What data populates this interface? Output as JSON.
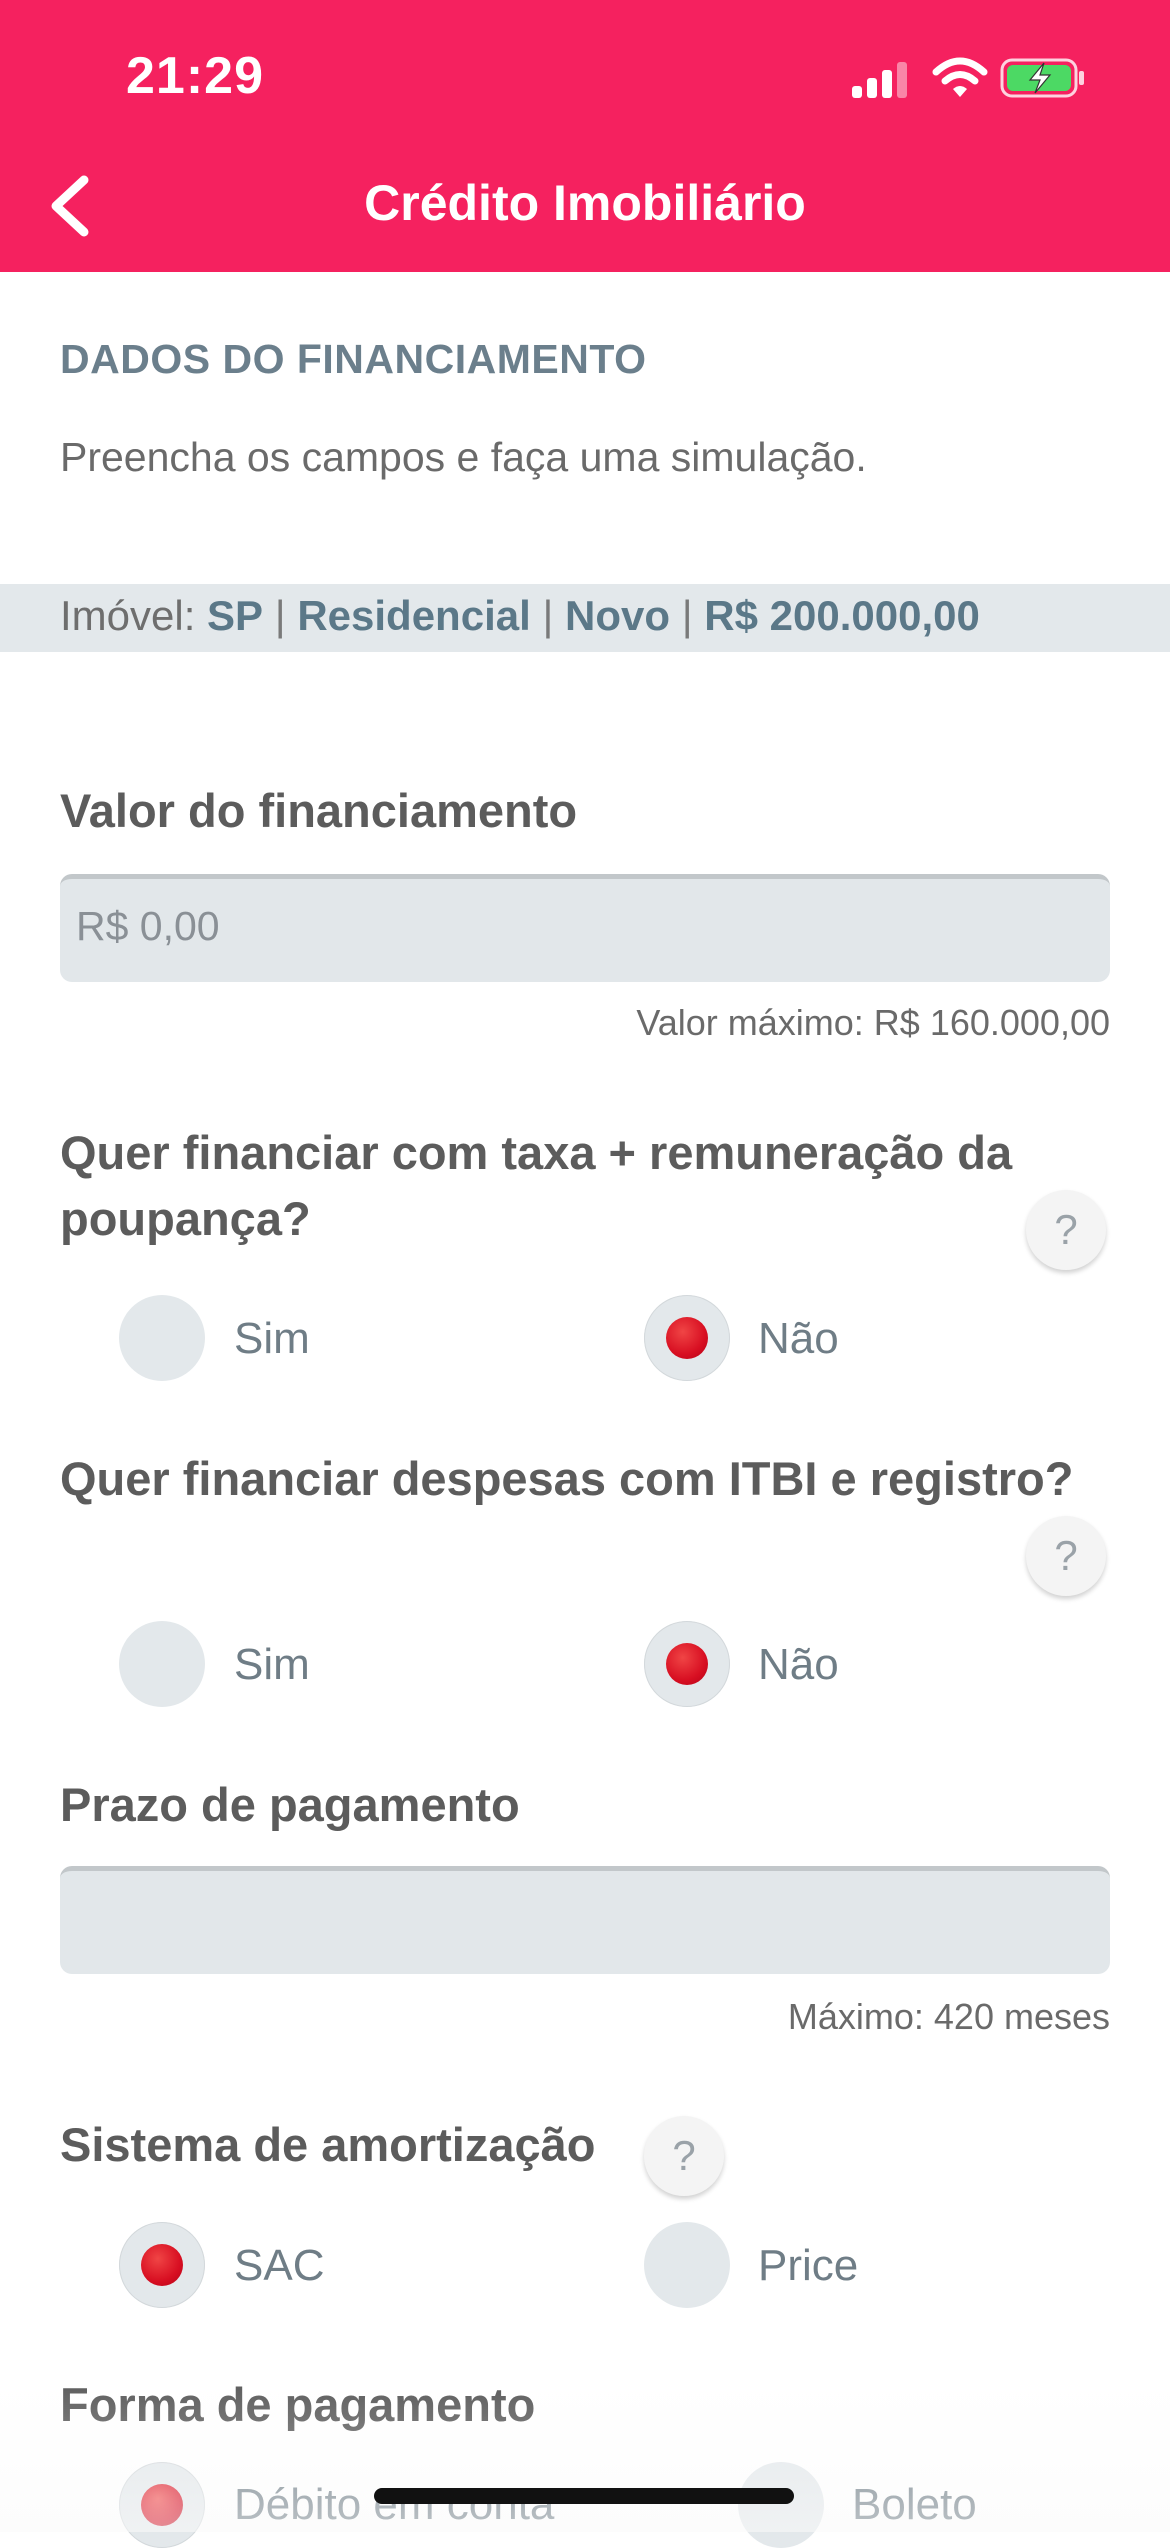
{
  "status_bar": {
    "time": "21:29"
  },
  "header": {
    "title": "Crédito Imobiliário",
    "back_icon": "chevron-left-icon"
  },
  "section": {
    "heading": "DADOS DO FINANCIAMENTO",
    "subtitle": "Preencha os campos e faça uma simulação."
  },
  "property": {
    "prefix": "Imóvel: ",
    "state": "SP",
    "type": "Residencial",
    "condition": "Novo",
    "value": "R$ 200.000,00",
    "separator": " | "
  },
  "financing_value": {
    "label": "Valor do financiamento",
    "placeholder": "R$ 0,00",
    "hint": "Valor máximo: R$ 160.000,00"
  },
  "savings_rate_question": {
    "line1": "Quer financiar com taxa + remuneração da",
    "line2": "poupança?",
    "help": "?",
    "options": [
      {
        "label": "Sim",
        "selected": false
      },
      {
        "label": "Não",
        "selected": true
      }
    ]
  },
  "itbi_question": {
    "label": "Quer financiar despesas com ITBI e registro?",
    "help": "?",
    "options": [
      {
        "label": "Sim",
        "selected": false
      },
      {
        "label": "Não",
        "selected": true
      }
    ]
  },
  "payment_term": {
    "label": "Prazo de pagamento",
    "value": "",
    "hint": "Máximo: 420 meses"
  },
  "amortization": {
    "label": "Sistema de amortização",
    "help": "?",
    "options": [
      {
        "label": "SAC",
        "selected": true
      },
      {
        "label": "Price",
        "selected": false
      }
    ]
  },
  "payment_method": {
    "label": "Forma de pagamento",
    "options": [
      {
        "label": "Débito em conta",
        "selected": true
      },
      {
        "label": "Boleto",
        "selected": false
      }
    ]
  },
  "colors": {
    "brand": "#f5215f",
    "selected_radio": "#d80f22",
    "heading_blue": "#6b7f8c"
  }
}
